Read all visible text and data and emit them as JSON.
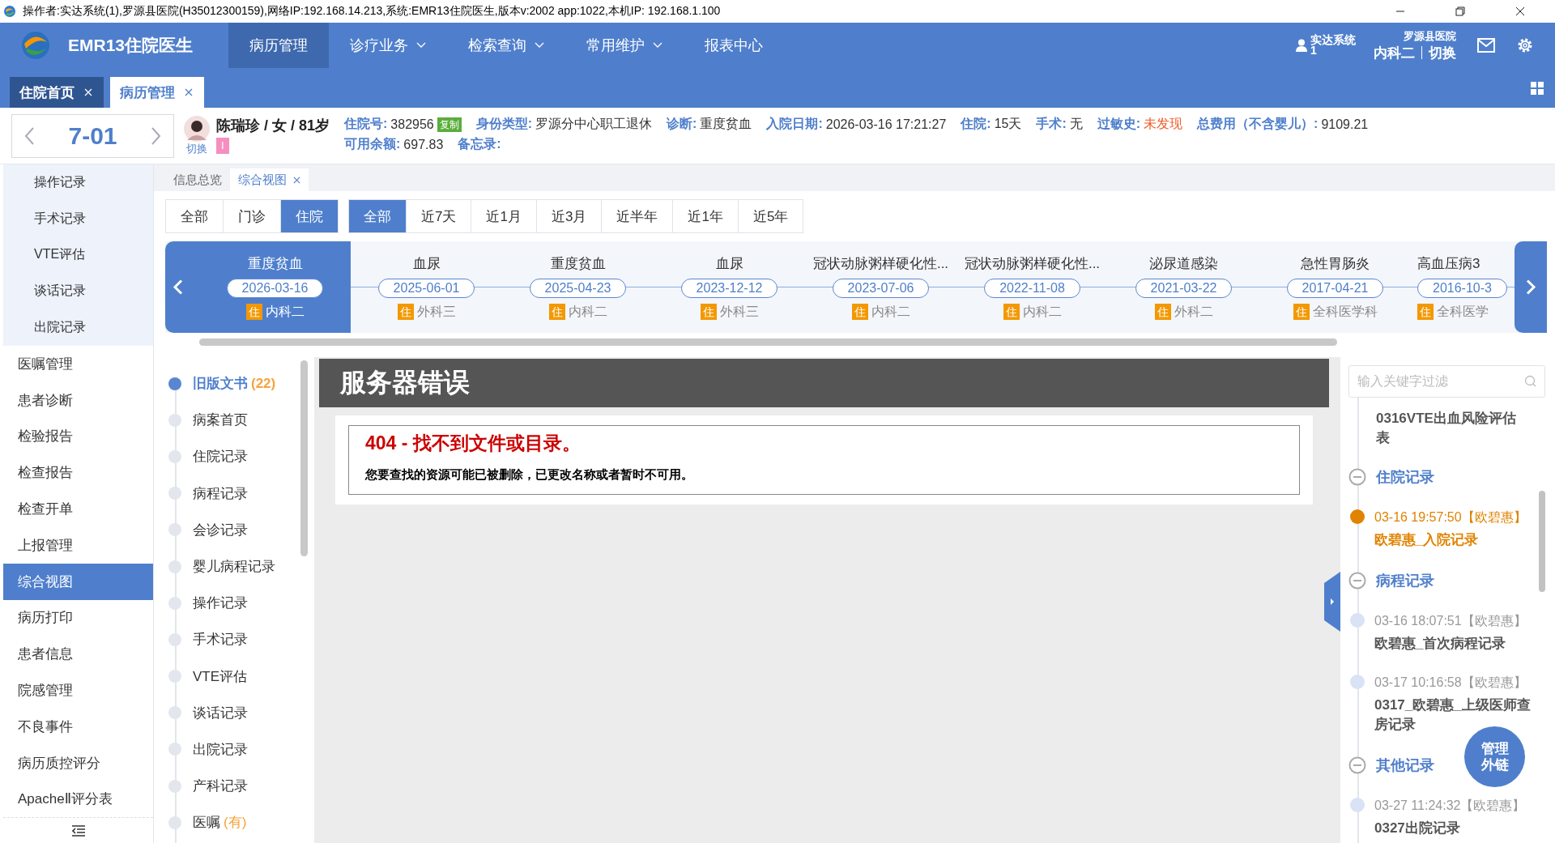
{
  "window": {
    "title": "操作者:实达系统(1),罗源县医院(H35012300159),网络IP:192.168.14.213,系统:EMR13住院医生,版本v:2002 app:1022,本机IP:  192.168.1.100"
  },
  "app": {
    "name": "EMR13住院医生"
  },
  "nav": [
    {
      "label": "病历管理",
      "selected": true,
      "dropdown": false
    },
    {
      "label": "诊疗业务",
      "selected": false,
      "dropdown": true
    },
    {
      "label": "检索查询",
      "selected": false,
      "dropdown": true
    },
    {
      "label": "常用维护",
      "selected": false,
      "dropdown": true
    },
    {
      "label": "报表中心",
      "selected": false,
      "dropdown": false
    }
  ],
  "user": {
    "name": "实达系统",
    "id": "1",
    "hospital": "罗源县医院",
    "dept": "内科二",
    "switch": "切换"
  },
  "page_tabs": [
    {
      "label": "住院首页",
      "selected": false,
      "closable": true
    },
    {
      "label": "病历管理",
      "selected": true,
      "closable": true
    }
  ],
  "bed": {
    "number": "7-01"
  },
  "patient": {
    "summary": "陈瑞珍 / 女 / 81岁",
    "avatar_label": "切换",
    "tag": "I",
    "rows": [
      [
        {
          "label": "住院号:",
          "value": "382956",
          "action": "复制",
          "alert": false
        },
        {
          "label": "身份类型:",
          "value": "罗源分中心职工退休",
          "alert": false
        },
        {
          "label": "诊断:",
          "value": "重度贫血",
          "alert": false
        },
        {
          "label": "入院日期:",
          "value": "2026-03-16 17:21:27",
          "alert": false
        },
        {
          "label": "住院:",
          "value": "15天",
          "alert": false
        },
        {
          "label": "手术:",
          "value": "无",
          "alert": false
        },
        {
          "label": "过敏史:",
          "value": "未发现",
          "alert": true
        },
        {
          "label": "总费用（不含婴儿）:",
          "value": "9109.21",
          "alert": false
        }
      ],
      [
        {
          "label": "可用余额:",
          "value": "697.83",
          "alert": false
        },
        {
          "label": "备忘录:"
        }
      ]
    ]
  },
  "sidebar": {
    "items": [
      {
        "label": "操作记录",
        "kind": "sub",
        "selected": false
      },
      {
        "label": "手术记录",
        "kind": "sub",
        "selected": false
      },
      {
        "label": "VTE评估",
        "kind": "sub",
        "selected": false
      },
      {
        "label": "谈话记录",
        "kind": "sub",
        "selected": false
      },
      {
        "label": "出院记录",
        "kind": "sub",
        "selected": false
      },
      {
        "label": "医嘱管理",
        "kind": "main",
        "selected": false
      },
      {
        "label": "患者诊断",
        "kind": "main",
        "selected": false
      },
      {
        "label": "检验报告",
        "kind": "main",
        "selected": false
      },
      {
        "label": "检查报告",
        "kind": "main",
        "selected": false
      },
      {
        "label": "检查开单",
        "kind": "main",
        "selected": false
      },
      {
        "label": "上报管理",
        "kind": "main",
        "selected": false
      },
      {
        "label": "综合视图",
        "kind": "main",
        "selected": true
      },
      {
        "label": "病历打印",
        "kind": "main",
        "selected": false
      },
      {
        "label": "患者信息",
        "kind": "main",
        "selected": false
      },
      {
        "label": "院感管理",
        "kind": "main",
        "selected": false
      },
      {
        "label": "不良事件",
        "kind": "main",
        "selected": false
      },
      {
        "label": "病历质控评分",
        "kind": "main",
        "selected": false
      },
      {
        "label": "ApacheⅡ评分表",
        "kind": "main",
        "selected": false
      }
    ]
  },
  "sub_tabs": [
    {
      "label": "信息总览",
      "selected": false,
      "closable": false
    },
    {
      "label": "综合视图",
      "selected": true,
      "closable": true
    }
  ],
  "filters": {
    "source": [
      {
        "label": "全部",
        "selected": false
      },
      {
        "label": "门诊",
        "selected": false
      },
      {
        "label": "住院",
        "selected": true
      }
    ],
    "period": [
      {
        "label": "全部",
        "selected": true
      },
      {
        "label": "近7天",
        "selected": false
      },
      {
        "label": "近1月",
        "selected": false
      },
      {
        "label": "近3月",
        "selected": false
      },
      {
        "label": "近半年",
        "selected": false
      },
      {
        "label": "近1年",
        "selected": false
      },
      {
        "label": "近5年",
        "selected": false
      }
    ]
  },
  "timeline": [
    {
      "title": "重度贫血",
      "date": "2026-03-16",
      "badge": "住",
      "dept": "内科二",
      "selected": true
    },
    {
      "title": "血尿",
      "date": "2025-06-01",
      "badge": "住",
      "dept": "外科三",
      "selected": false
    },
    {
      "title": "重度贫血",
      "date": "2025-04-23",
      "badge": "住",
      "dept": "内科二",
      "selected": false
    },
    {
      "title": "血尿",
      "date": "2023-12-12",
      "badge": "住",
      "dept": "外科三",
      "selected": false
    },
    {
      "title": "冠状动脉粥样硬化性...",
      "date": "2023-07-06",
      "badge": "住",
      "dept": "内科二",
      "selected": false
    },
    {
      "title": "冠状动脉粥样硬化性...",
      "date": "2022-11-08",
      "badge": "住",
      "dept": "内科二",
      "selected": false
    },
    {
      "title": "泌尿道感染",
      "date": "2021-03-22",
      "badge": "住",
      "dept": "外科二",
      "selected": false
    },
    {
      "title": "急性胃肠炎",
      "date": "2017-04-21",
      "badge": "住",
      "dept": "全科医学科",
      "selected": false
    },
    {
      "title": "高血压病3",
      "date": "2016-10-3",
      "badge": "住",
      "dept": "全科医学",
      "selected": false
    }
  ],
  "doc_list": [
    {
      "label": "旧版文书",
      "count": "(22)",
      "selected": true
    },
    {
      "label": "病案首页",
      "selected": false
    },
    {
      "label": "住院记录",
      "selected": false
    },
    {
      "label": "病程记录",
      "selected": false
    },
    {
      "label": "会诊记录",
      "selected": false
    },
    {
      "label": "婴儿病程记录",
      "selected": false
    },
    {
      "label": "操作记录",
      "selected": false
    },
    {
      "label": "手术记录",
      "selected": false
    },
    {
      "label": "VTE评估",
      "selected": false
    },
    {
      "label": "谈话记录",
      "selected": false
    },
    {
      "label": "出院记录",
      "selected": false
    },
    {
      "label": "产科记录",
      "selected": false
    },
    {
      "label": "医嘱",
      "count": "(有)",
      "selected": false
    }
  ],
  "error_page": {
    "header": "服务器错误",
    "title": "404 - 找不到文件或目录。",
    "message": "您要查找的资源可能已被删除，已更改名称或者暂时不可用。"
  },
  "record_panel": {
    "search": {
      "placeholder": "输入关键字过滤"
    },
    "items": [
      {
        "kind": "doc",
        "title": "0316VTE出血风险评估表"
      },
      {
        "kind": "group",
        "title": "住院记录"
      },
      {
        "kind": "entry",
        "meta": "03-16 19:57:50【欧碧惠】",
        "title": "欧碧惠_入院记录",
        "selected": true
      },
      {
        "kind": "group",
        "title": "病程记录"
      },
      {
        "kind": "entry",
        "meta": "03-16 18:07:51【欧碧惠】",
        "title": "欧碧惠_首次病程记录",
        "selected": false
      },
      {
        "kind": "entry",
        "meta": "03-17 10:16:58【欧碧惠】",
        "title": "0317_欧碧惠_上级医师查房记录",
        "selected": false
      },
      {
        "kind": "group",
        "title": "其他记录"
      },
      {
        "kind": "entry",
        "meta": "03-27 11:24:32【欧碧惠】",
        "title": "0327出院记录",
        "selected": false
      }
    ],
    "float_button": "管理外链"
  }
}
